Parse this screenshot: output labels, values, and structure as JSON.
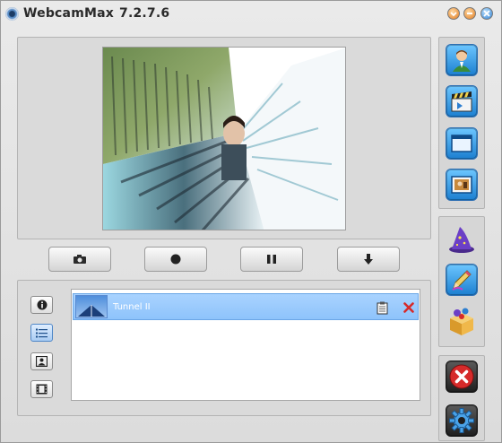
{
  "window": {
    "title": "WebcamMax",
    "version": "7.2.7.6"
  },
  "title_buttons": [
    {
      "name": "help-button",
      "icon": "help-icon"
    },
    {
      "name": "minimize-button",
      "icon": "minimize-icon"
    },
    {
      "name": "close-button",
      "icon": "close-icon"
    }
  ],
  "preview": {
    "effect_applied": "Tunnel II"
  },
  "controls": [
    {
      "name": "snapshot-button",
      "icon": "camera-icon"
    },
    {
      "name": "record-button",
      "icon": "record-icon"
    },
    {
      "name": "pause-button",
      "icon": "pause-icon"
    },
    {
      "name": "download-button",
      "icon": "download-arrow-icon"
    }
  ],
  "side_tabs": [
    {
      "name": "tab-info",
      "icon": "info-icon",
      "active": false
    },
    {
      "name": "tab-list",
      "icon": "list-icon",
      "active": true
    },
    {
      "name": "tab-portrait",
      "icon": "portrait-icon",
      "active": false
    },
    {
      "name": "tab-film",
      "icon": "film-icon",
      "active": false
    }
  ],
  "effects": [
    {
      "label": "Tunnel II",
      "selected": true
    }
  ],
  "toolbar": [
    {
      "name": "user-button",
      "icon": "user-icon"
    },
    {
      "name": "media-button",
      "icon": "clapperboard-icon"
    },
    {
      "name": "window-button",
      "icon": "window-icon"
    },
    {
      "name": "picture-button",
      "icon": "picture-icon"
    },
    {
      "name": "magic-button",
      "icon": "wizard-hat-icon"
    },
    {
      "name": "draw-button",
      "icon": "pencil-icon"
    },
    {
      "name": "effects-box-button",
      "icon": "box-icon"
    },
    {
      "name": "stop-button",
      "icon": "x-stop-icon"
    },
    {
      "name": "settings-button",
      "icon": "gear-icon"
    }
  ],
  "colors": {
    "accent_blue": "#2e7fd0",
    "selection": "#9ccbfd",
    "delete_red": "#d62a2a"
  }
}
